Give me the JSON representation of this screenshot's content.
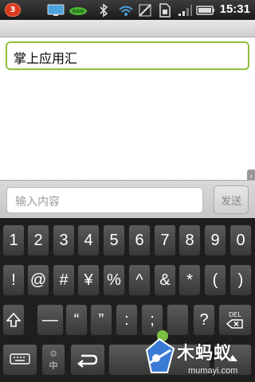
{
  "status": {
    "notification_count": "3",
    "time": "15:31",
    "icons": [
      "notification-badge",
      "monitor-icon",
      "pea-app-icon",
      "bluetooth-icon",
      "wifi-icon",
      "signal-edit-icon",
      "sim-icon",
      "cell-signal-icon",
      "battery-icon"
    ]
  },
  "app": {
    "title_field_value": "掌上应用汇"
  },
  "composer": {
    "placeholder": "输入内容",
    "send_label": "发送"
  },
  "keyboard": {
    "row1": [
      "1",
      "2",
      "3",
      "4",
      "5",
      "6",
      "7",
      "8",
      "9",
      "0"
    ],
    "row2": [
      "!",
      "@",
      "#",
      "¥",
      "%",
      "^",
      "&",
      "*",
      "(",
      ")"
    ],
    "row3_keys": [
      "—",
      "“",
      "”",
      ":",
      ";",
      "?"
    ],
    "del_label": "DEL",
    "mode_label": "中",
    "colors": {
      "key_bg": "#4a4a4a",
      "keyboard_bg": "#1e1e1e",
      "accent_green": "#8fbf3f"
    }
  },
  "watermark": {
    "text": "木蚂蚁",
    "url": "mumayi.com"
  }
}
